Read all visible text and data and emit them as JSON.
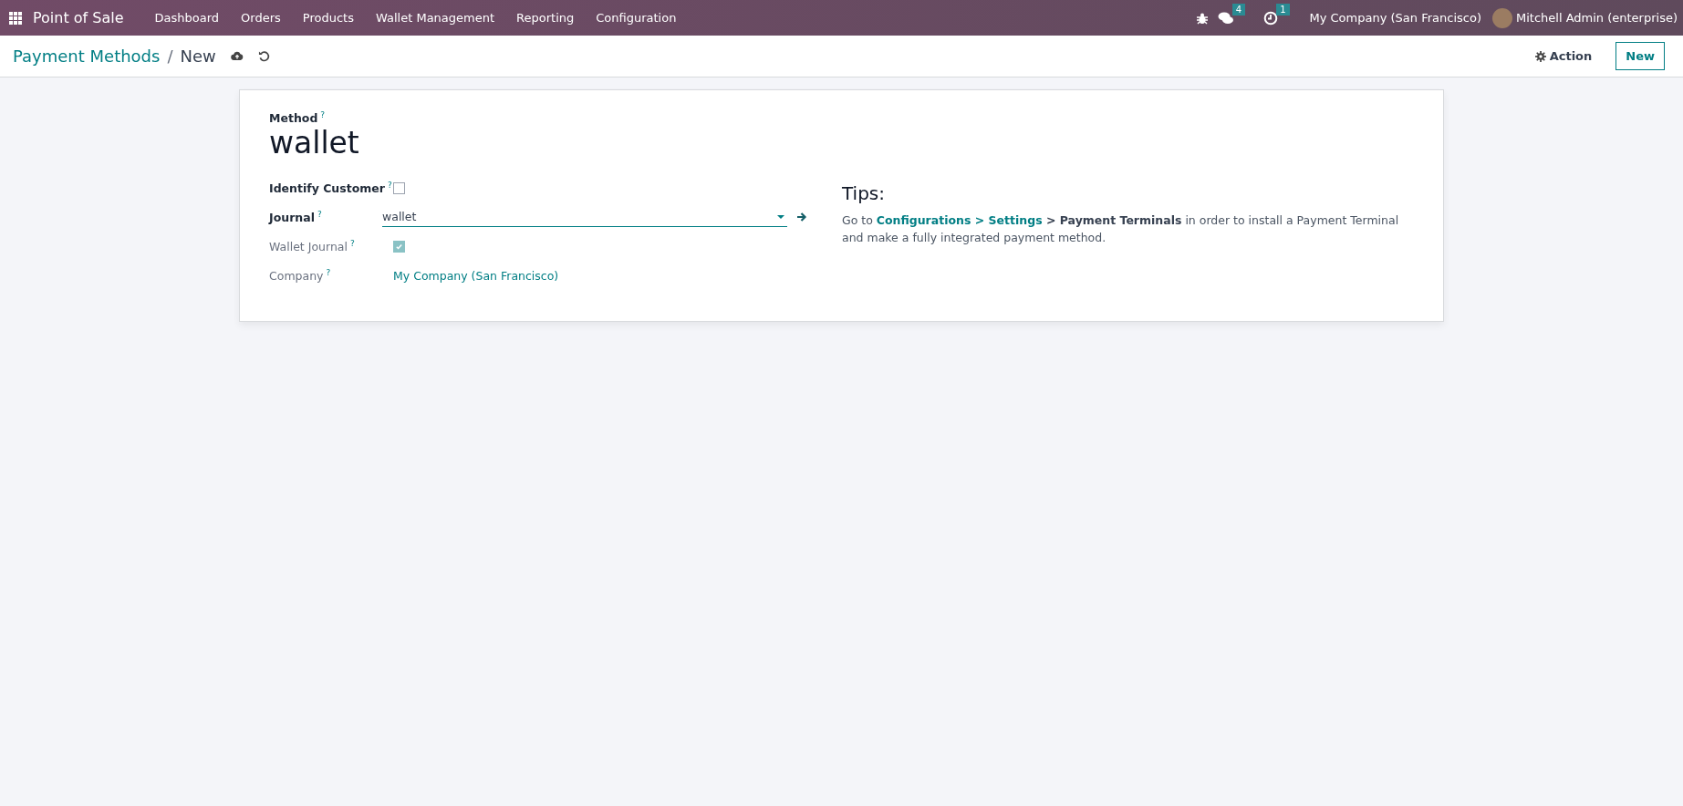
{
  "navbar": {
    "app_name": "Point of Sale",
    "menu": [
      "Dashboard",
      "Orders",
      "Products",
      "Wallet Management",
      "Reporting",
      "Configuration"
    ],
    "systray": [
      {
        "kind": "bug"
      },
      {
        "kind": "messages",
        "badge": "4"
      },
      {
        "kind": "activity",
        "badge": "1"
      },
      {
        "kind": "company",
        "label": "My Company (San Francisco)"
      },
      {
        "kind": "user",
        "label": "Mitchell Admin (enterprise)"
      }
    ]
  },
  "control_panel": {
    "breadcrumb": [
      {
        "label": "Payment Methods"
      },
      {
        "label": "New"
      }
    ],
    "separator": "/",
    "action_label": "Action",
    "new_label": "New"
  },
  "form": {
    "title_label": "Method",
    "title_help": "?",
    "title_value": "wallet",
    "fields": [
      {
        "kind": "checkbox",
        "label": "Identify Customer",
        "help": "?",
        "required": true,
        "checked": false
      },
      {
        "kind": "many2one",
        "label": "Journal",
        "help": "?",
        "required": true,
        "value": "wallet"
      },
      {
        "kind": "checkbox",
        "label": "Wallet Journal",
        "help": "?",
        "required": false,
        "checked": true
      },
      {
        "kind": "link",
        "label": "Company",
        "help": "?",
        "required": false,
        "value": "My Company (San Francisco)"
      }
    ],
    "tips": {
      "title": "Tips:",
      "parts": [
        {
          "kind": "text",
          "text": "Go to "
        },
        {
          "kind": "link",
          "text": "Configurations > Settings"
        },
        {
          "kind": "bold",
          "text": " > Payment Terminals"
        },
        {
          "kind": "text",
          "text": " in order to install a Payment Terminal and make a fully integrated payment method."
        }
      ]
    }
  }
}
